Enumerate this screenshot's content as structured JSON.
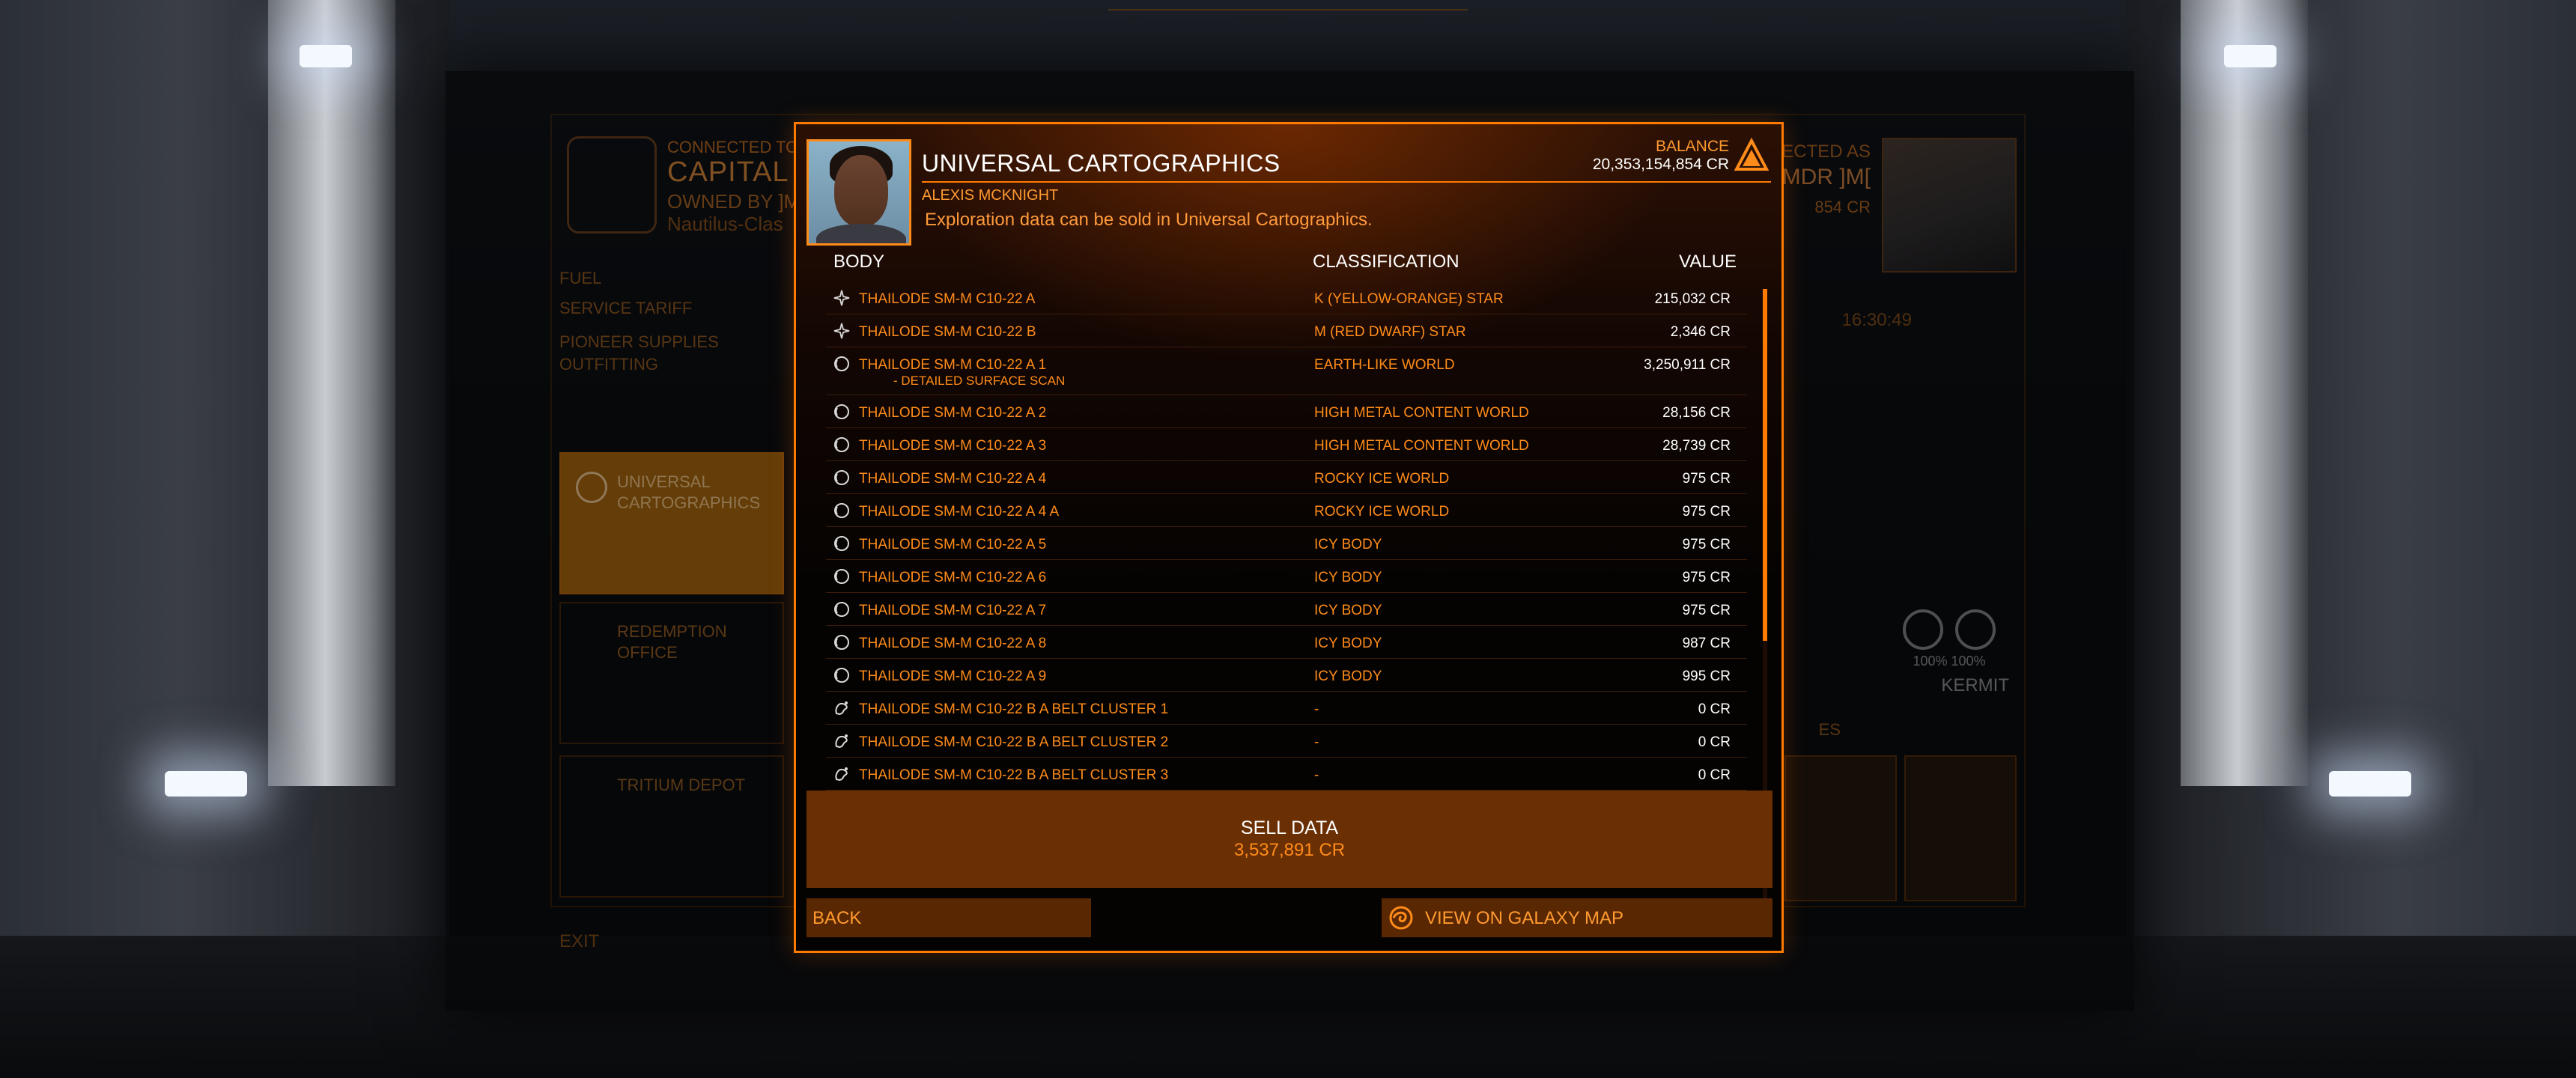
{
  "station": {
    "connected_label": "CONNECTED TO",
    "name": "CAPITAL ]",
    "owner": "OWNED BY ]M[",
    "ship": "Nautilus-Clas",
    "services": [
      "FUEL",
      "SERVICE TARIFF",
      "PIONEER SUPPLIES",
      "OUTFITTING"
    ],
    "tiles": [
      "UNIVERSAL CARTOGRAPHICS",
      "REDEMPTION OFFICE",
      "TRITIUM DEPOT"
    ],
    "exit_label": "EXIT",
    "cmdr_label": "ECTED AS",
    "cmdr_name": "MDR ]M[",
    "cmdr_credits": "854 CR",
    "clock": "16:30:49",
    "gauge_left": "100%",
    "gauge_right": "100%",
    "ship_name": "KERMIT",
    "services_hdr": "ES"
  },
  "dialog": {
    "title": "UNIVERSAL CARTOGRAPHICS",
    "contact": "ALEXIS MCKNIGHT",
    "description": "Exploration data can be sold in Universal Cartographics.",
    "balance_label": "BALANCE",
    "balance_value": "20,353,154,854 CR",
    "columns": {
      "body": "BODY",
      "classification": "CLASSIFICATION",
      "value": "VALUE"
    },
    "sell_label": "SELL DATA",
    "sell_amount": "3,537,891 CR",
    "back_label": "BACK",
    "galaxy_label": "VIEW ON GALAXY MAP",
    "accent_color": "#ff7a00",
    "rows": [
      {
        "icon": "star-icon",
        "name": "THAILODE SM-M C10-22 A",
        "sub": "",
        "classification": "K (YELLOW-ORANGE) STAR",
        "value": "215,032 CR"
      },
      {
        "icon": "star-icon",
        "name": "THAILODE SM-M C10-22 B",
        "sub": "",
        "classification": "M (RED DWARF) STAR",
        "value": "2,346 CR"
      },
      {
        "icon": "planet-icon",
        "name": "THAILODE SM-M C10-22 A 1",
        "sub": "- DETAILED SURFACE SCAN",
        "classification": "EARTH-LIKE WORLD",
        "value": "3,250,911 CR"
      },
      {
        "icon": "planet-icon",
        "name": "THAILODE SM-M C10-22 A 2",
        "sub": "",
        "classification": "HIGH METAL CONTENT WORLD",
        "value": "28,156 CR"
      },
      {
        "icon": "planet-icon",
        "name": "THAILODE SM-M C10-22 A 3",
        "sub": "",
        "classification": "HIGH METAL CONTENT WORLD",
        "value": "28,739 CR"
      },
      {
        "icon": "planet-icon",
        "name": "THAILODE SM-M C10-22 A 4",
        "sub": "",
        "classification": "ROCKY ICE WORLD",
        "value": "975 CR"
      },
      {
        "icon": "planet-icon",
        "name": "THAILODE SM-M C10-22 A 4 A",
        "sub": "",
        "classification": "ROCKY ICE WORLD",
        "value": "975 CR"
      },
      {
        "icon": "planet-icon",
        "name": "THAILODE SM-M C10-22 A 5",
        "sub": "",
        "classification": "ICY BODY",
        "value": "975 CR"
      },
      {
        "icon": "planet-icon",
        "name": "THAILODE SM-M C10-22 A 6",
        "sub": "",
        "classification": "ICY BODY",
        "value": "975 CR"
      },
      {
        "icon": "planet-icon",
        "name": "THAILODE SM-M C10-22 A 7",
        "sub": "",
        "classification": "ICY BODY",
        "value": "975 CR"
      },
      {
        "icon": "planet-icon",
        "name": "THAILODE SM-M C10-22 A 8",
        "sub": "",
        "classification": "ICY BODY",
        "value": "987 CR"
      },
      {
        "icon": "planet-icon",
        "name": "THAILODE SM-M C10-22 A 9",
        "sub": "",
        "classification": "ICY BODY",
        "value": "995 CR"
      },
      {
        "icon": "asteroid-icon",
        "name": "THAILODE SM-M C10-22 B A BELT CLUSTER 1",
        "sub": "",
        "classification": "-",
        "value": "0 CR"
      },
      {
        "icon": "asteroid-icon",
        "name": "THAILODE SM-M C10-22 B A BELT CLUSTER 2",
        "sub": "",
        "classification": "-",
        "value": "0 CR"
      },
      {
        "icon": "asteroid-icon",
        "name": "THAILODE SM-M C10-22 B A BELT CLUSTER 3",
        "sub": "",
        "classification": "-",
        "value": "0 CR"
      }
    ]
  }
}
